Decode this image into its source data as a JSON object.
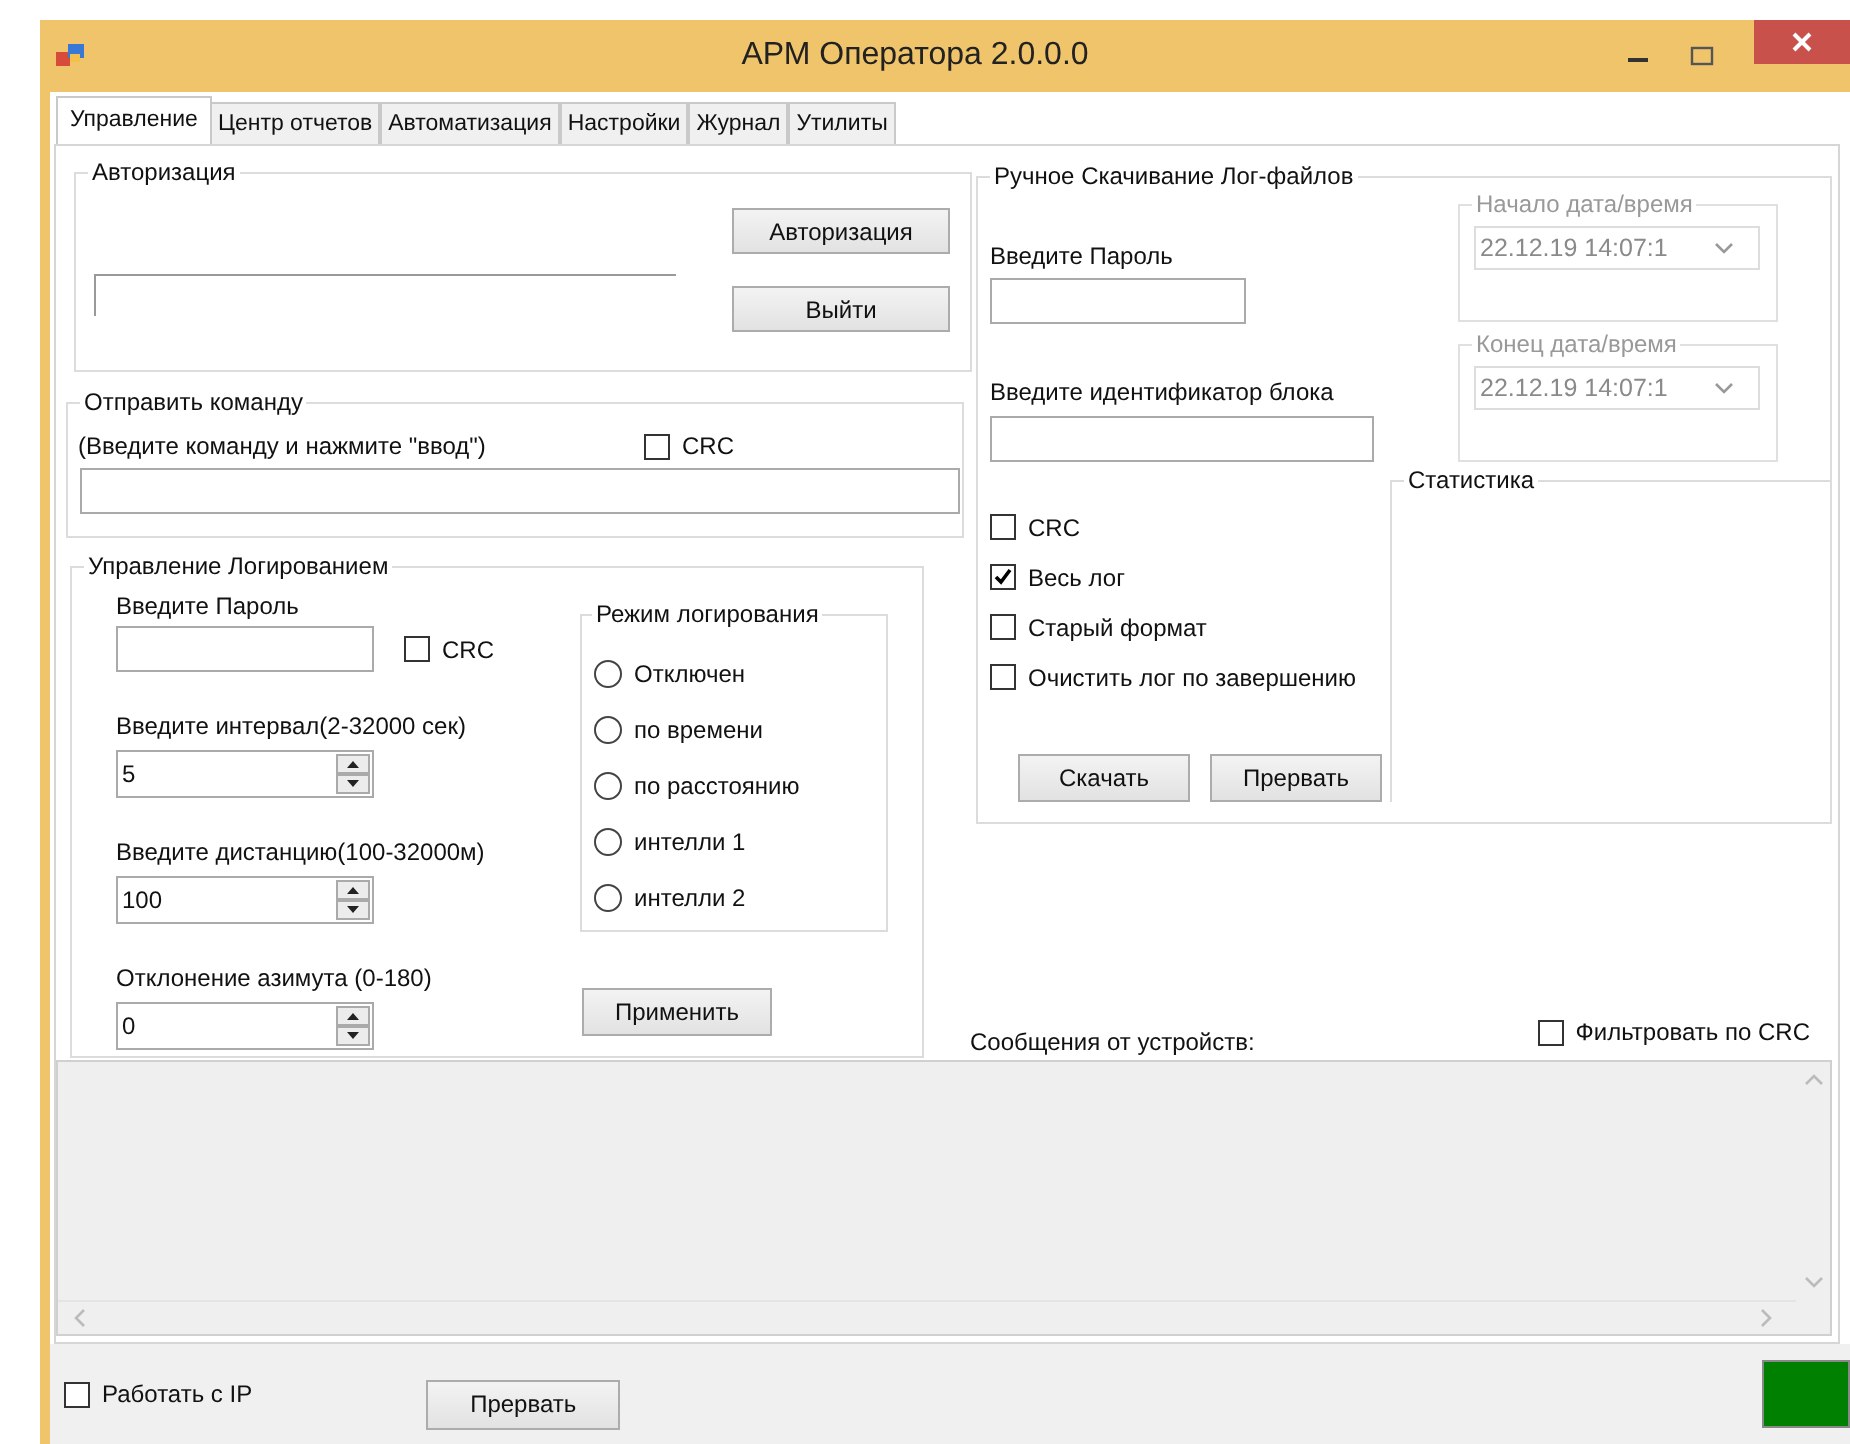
{
  "window": {
    "title": "АРМ Оператора  2.0.0.0"
  },
  "tabs": [
    {
      "label": "Управление",
      "selected": true
    },
    {
      "label": "Центр отчетов",
      "selected": false
    },
    {
      "label": "Автоматизация",
      "selected": false
    },
    {
      "label": "Настройки",
      "selected": false
    },
    {
      "label": "Журнал",
      "selected": false
    },
    {
      "label": "Утилиты",
      "selected": false
    }
  ],
  "auth": {
    "title": "Авторизация",
    "buttons": [
      "Авторизация",
      "Выйти"
    ]
  },
  "send_command": {
    "title": "Отправить команду",
    "hint": "(Введите команду и нажмите \"ввод\")",
    "crc": {
      "label": "CRC",
      "checked": false
    }
  },
  "logging": {
    "title": "Управление Логированием",
    "password_label": "Введите Пароль",
    "crc": {
      "label": "CRC",
      "checked": false
    },
    "spinners": [
      {
        "label": "Введите интервал(2-32000 сек)",
        "value": "5"
      },
      {
        "label": "Введите дистанцию(100-32000м)",
        "value": "100"
      },
      {
        "label": "Отклонение азимута (0-180)",
        "value": "0"
      }
    ],
    "mode": {
      "title": "Режим логирования",
      "options": [
        {
          "label": "Отключен",
          "selected": false
        },
        {
          "label": "по времени",
          "selected": false
        },
        {
          "label": "по расстоянию",
          "selected": false
        },
        {
          "label": "интелли 1",
          "selected": false
        },
        {
          "label": "интелли 2",
          "selected": false
        }
      ]
    },
    "apply_button": "Применить"
  },
  "download": {
    "title": "Ручное Скачивание Лог-файлов",
    "password_label": "Введите Пароль",
    "block_label": "Введите идентификатор блока",
    "options": [
      {
        "label": "CRC",
        "checked": false
      },
      {
        "label": "Весь лог",
        "checked": true
      },
      {
        "label": "Старый формат",
        "checked": false
      },
      {
        "label": "Очистить лог по завершению",
        "checked": false
      }
    ],
    "buttons": [
      "Скачать",
      "Прервать"
    ],
    "dates": [
      {
        "title": "Начало дата/время",
        "value": "22.12.19 14:07:1",
        "disabled": true
      },
      {
        "title": "Конец дата/время",
        "value": "22.12.19 14:07:1",
        "disabled": true
      }
    ]
  },
  "statistics": {
    "title": "Статистика"
  },
  "messages": {
    "label": "Сообщения от устройств:",
    "filter": {
      "label": "Фильтровать по CRC",
      "checked": false
    }
  },
  "footer": {
    "ip": {
      "label": "Работать с IP",
      "checked": false
    },
    "stop_button": "Прервать",
    "connection": {
      "on": true
    }
  }
}
